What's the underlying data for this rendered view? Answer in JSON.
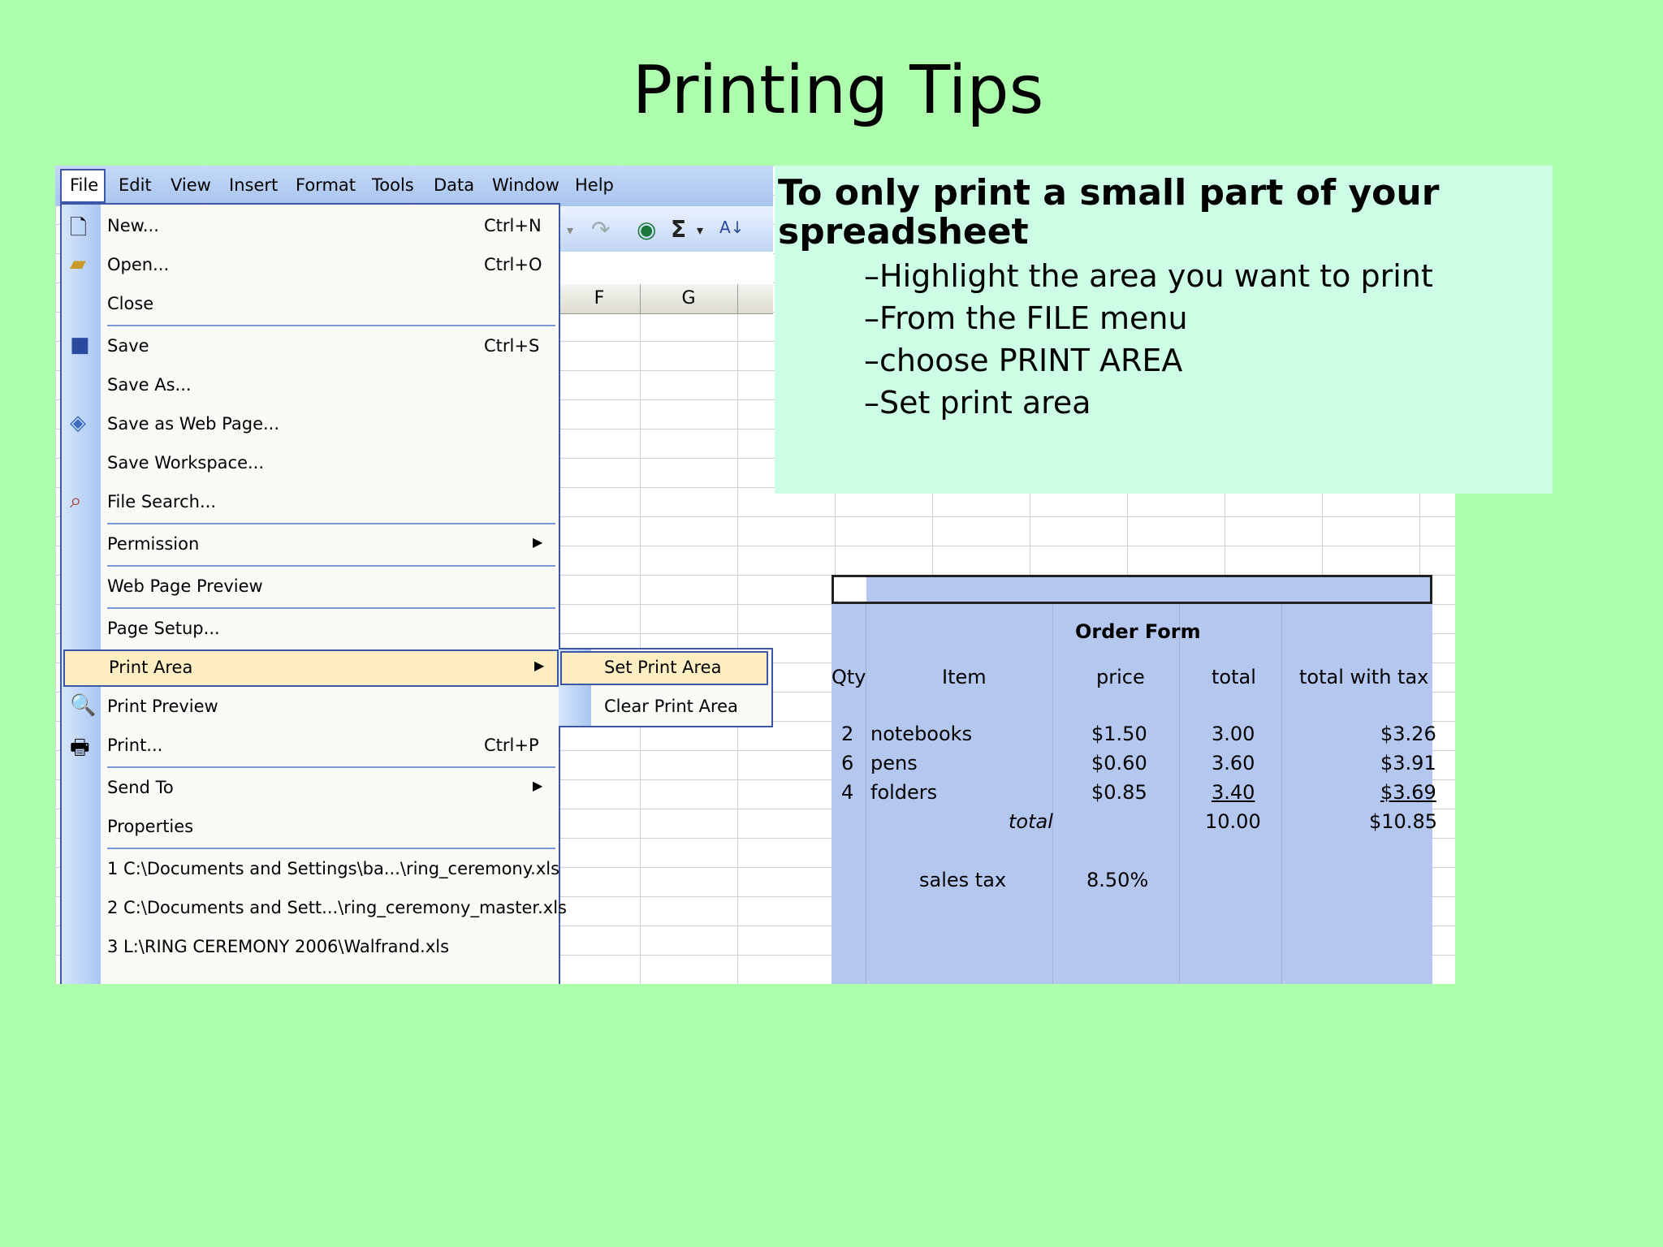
{
  "slide": {
    "title": "Printing Tips",
    "heading": "To only print a small part of your spreadsheet",
    "bullets": [
      "–Highlight the area you want to print",
      "–From the FILE menu",
      "–choose PRINT AREA",
      "–Set print area"
    ]
  },
  "menubar": [
    "File",
    "Edit",
    "View",
    "Insert",
    "Format",
    "Tools",
    "Data",
    "Window",
    "Help"
  ],
  "columns": [
    "F",
    "G"
  ],
  "file_menu": [
    {
      "label": "New...",
      "shortcut": "Ctrl+N",
      "icon": "new-document-icon"
    },
    {
      "label": "Open...",
      "shortcut": "Ctrl+O",
      "icon": "open-folder-icon"
    },
    {
      "label": "Close",
      "shortcut": ""
    },
    {
      "label": "Save",
      "shortcut": "Ctrl+S",
      "icon": "save-disk-icon"
    },
    {
      "label": "Save As...",
      "shortcut": ""
    },
    {
      "label": "Save as Web Page...",
      "shortcut": "",
      "icon": "web-page-icon"
    },
    {
      "label": "Save Workspace...",
      "shortcut": ""
    },
    {
      "label": "File Search...",
      "shortcut": "",
      "icon": "file-search-icon"
    },
    {
      "label": "Permission",
      "shortcut": "",
      "submenu": true
    },
    {
      "label": "Web Page Preview",
      "shortcut": ""
    },
    {
      "label": "Page Setup...",
      "shortcut": ""
    },
    {
      "label": "Print Area",
      "shortcut": "",
      "submenu": true,
      "highlighted": true
    },
    {
      "label": "Print Preview",
      "shortcut": "",
      "icon": "print-preview-icon"
    },
    {
      "label": "Print...",
      "shortcut": "Ctrl+P",
      "icon": "printer-icon"
    },
    {
      "label": "Send To",
      "shortcut": "",
      "submenu": true
    },
    {
      "label": "Properties",
      "shortcut": ""
    },
    {
      "label": "1 C:\\Documents and Settings\\ba...\\ring_ceremony.xls",
      "shortcut": ""
    },
    {
      "label": "2 C:\\Documents and Sett...\\ring_ceremony_master.xls",
      "shortcut": ""
    },
    {
      "label": "3 L:\\RING CEREMONY 2006\\Walfrand.xls",
      "shortcut": ""
    }
  ],
  "submenu": [
    "Set Print Area",
    "Clear Print Area"
  ],
  "order_form": {
    "title": "Order Form",
    "headers": [
      "Qty",
      "Item",
      "price",
      "total",
      "total with tax"
    ],
    "rows": [
      [
        "2",
        "notebooks",
        "$1.50",
        "3.00",
        "$3.26"
      ],
      [
        "6",
        "pens",
        "$0.60",
        "3.60",
        "$3.91"
      ],
      [
        "4",
        "folders",
        "$0.85",
        "3.40",
        "$3.69"
      ]
    ],
    "total_label": "total",
    "total_value": "10.00",
    "total_with_tax": "$10.85",
    "tax_label": "sales tax",
    "tax_value": "8.50%"
  },
  "colors": {
    "background": "#adffad",
    "textbox": "#ccffe6",
    "selection": "#b4c7ee",
    "menu_highlight": "#ffeec2"
  }
}
